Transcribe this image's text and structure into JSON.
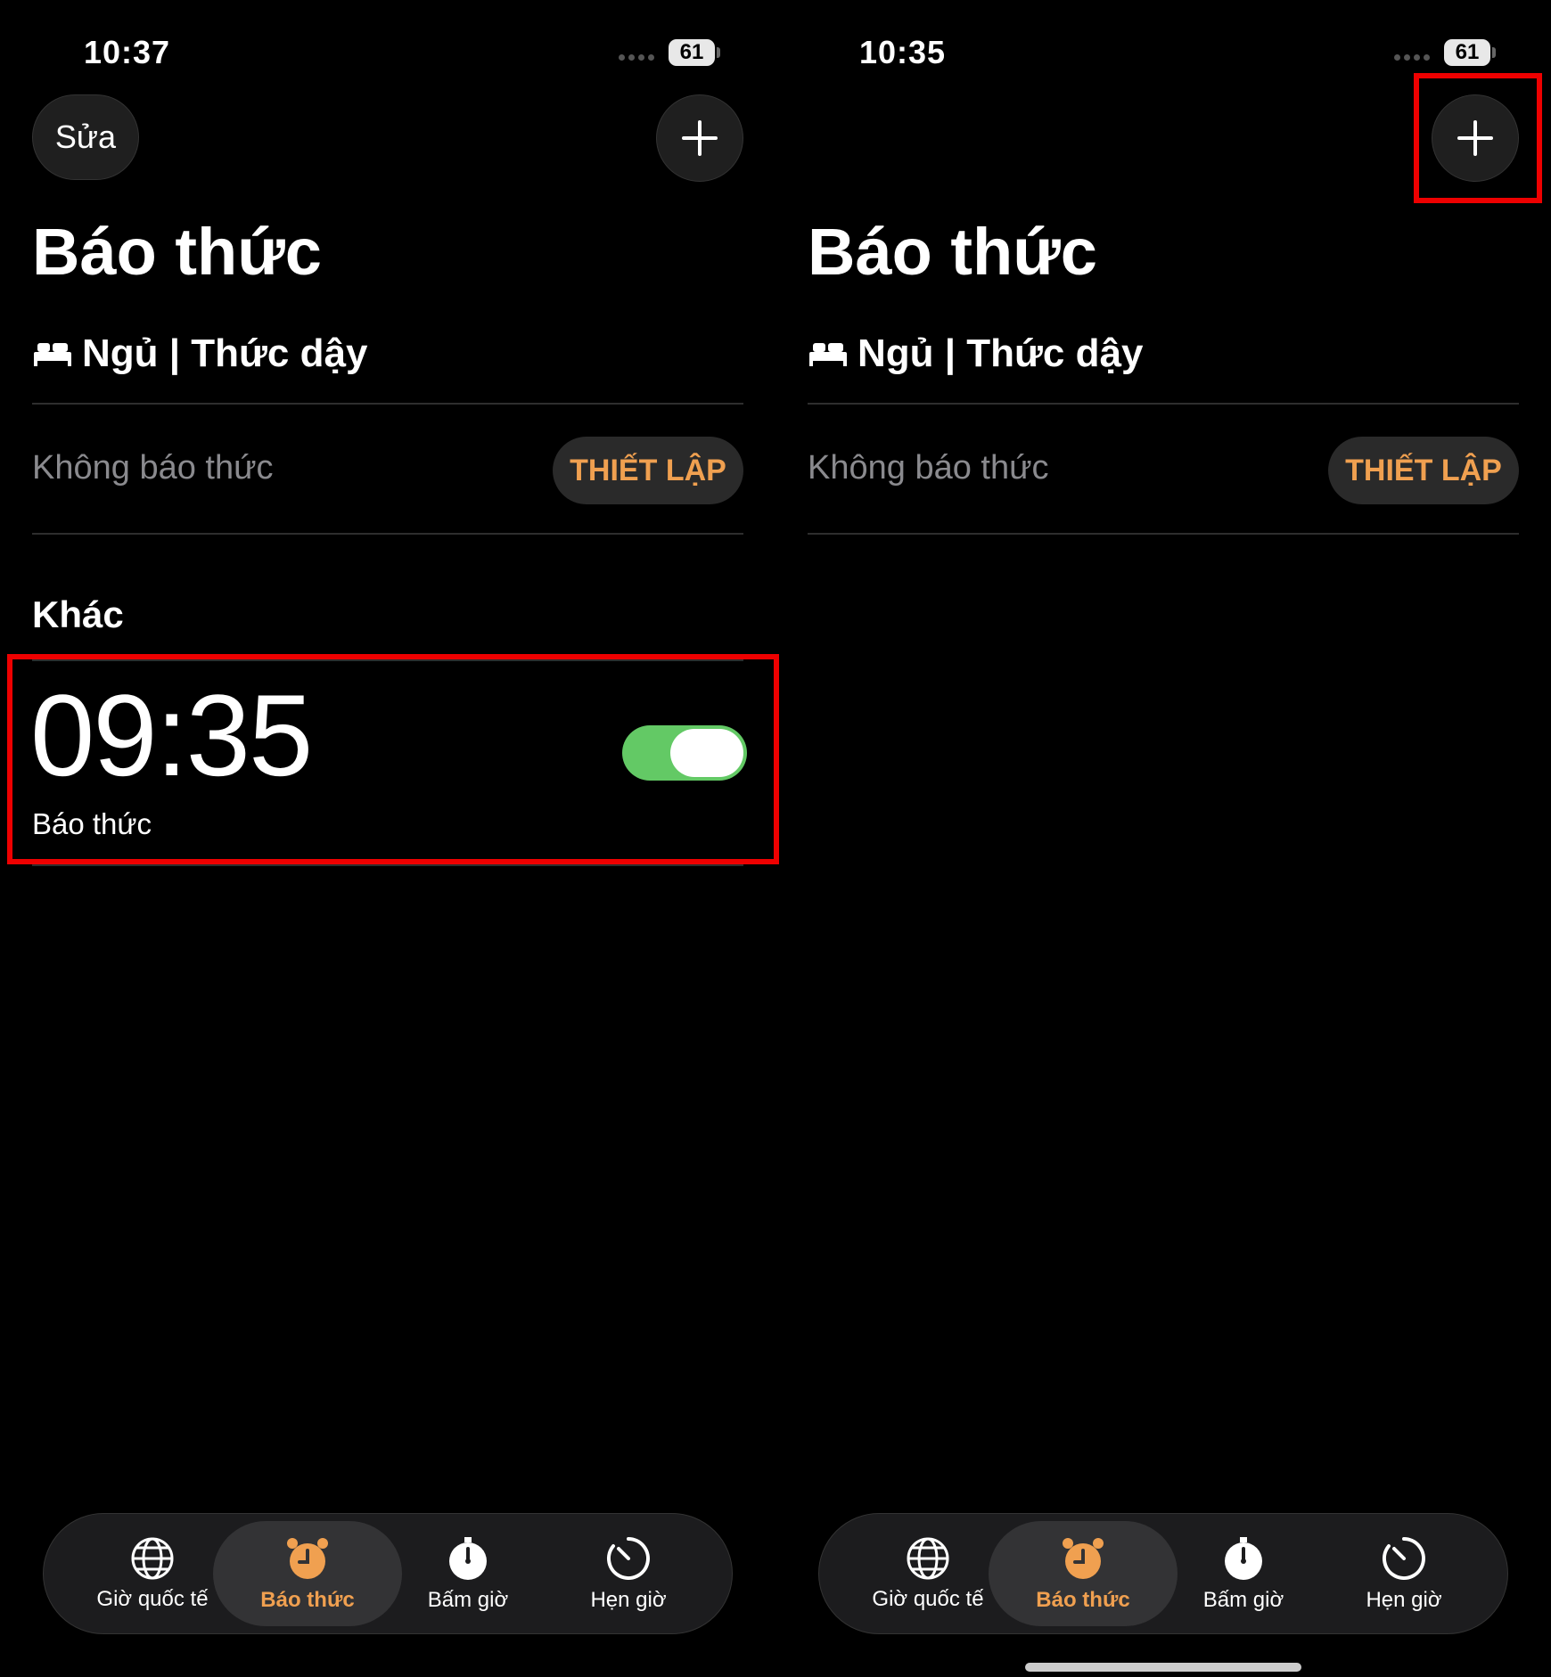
{
  "left": {
    "status_time": "10:37",
    "battery": "61",
    "edit_label": "Sửa",
    "title": "Báo thức",
    "sleep_section": "Ngủ | Thức dậy",
    "no_alarm_text": "Không báo thức",
    "setup_label": "THIẾT LẬP",
    "other_section": "Khác",
    "alarm": {
      "time": "09:35",
      "label": "Báo thức",
      "enabled": true
    }
  },
  "right": {
    "status_time": "10:35",
    "battery": "61",
    "title": "Báo thức",
    "sleep_section": "Ngủ | Thức dậy",
    "no_alarm_text": "Không báo thức",
    "setup_label": "THIẾT LẬP"
  },
  "tabs": [
    {
      "label": "Giờ quốc tế",
      "icon": "globe-icon"
    },
    {
      "label": "Báo thức",
      "icon": "alarm-clock-icon",
      "active": true
    },
    {
      "label": "Bấm giờ",
      "icon": "stopwatch-icon"
    },
    {
      "label": "Hẹn giờ",
      "icon": "timer-icon"
    }
  ],
  "colors": {
    "accent": "#f0a050",
    "toggle_on": "#63c965",
    "highlight": "#ee0000",
    "background": "#000000"
  }
}
